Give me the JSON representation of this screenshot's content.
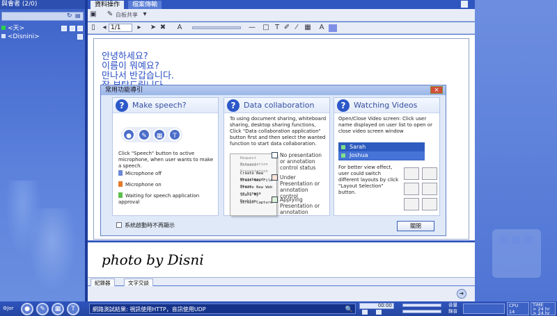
{
  "left_panel": {
    "header": "與會者 (2/0)",
    "users": [
      {
        "name": "<天>",
        "status_color": "#2bd14b"
      },
      {
        "name": "<Disnini>",
        "status_color": "#d9e4fb"
      }
    ]
  },
  "tabs": [
    {
      "label": "資料操作",
      "active": true
    },
    {
      "label": "檔案傳輸",
      "active": false
    }
  ],
  "toolbar1": {
    "whiteboard_share": "白板共享"
  },
  "toolbar2": {
    "page_value": "1/1"
  },
  "whiteboard": {
    "korean_lines": [
      "안녕하세요?",
      "이름이 뭐예요?",
      "만나서 반갑습니다.",
      "잘 부탁드립니다."
    ]
  },
  "dialog": {
    "title": "常用功能導引",
    "close_label": "×",
    "panels": {
      "speech": {
        "title": "Make speech?",
        "description": "Click \"Speech\" button to active microphone, when user wants to make a speech.",
        "legend": [
          {
            "label": "Microphone off",
            "color": "#6a88d6"
          },
          {
            "label": "Microphone on",
            "color": "#e47b2d"
          },
          {
            "label": "Waiting for speech application approval",
            "color": "#5cbf4e"
          }
        ]
      },
      "collab": {
        "title": "Data collaboration",
        "description": "To using document sharing, whiteboard sharing, desktop sharing functions, Click \"Data collaboration application\" button first and then select the wanted function to start data collaboration.",
        "menu_items": [
          "Request Presentation",
          "Release Presentation",
          "Create New Whiteboard",
          "Creat New File Share",
          "Create New Web co-browse",
          "Share My Desktop",
          "Screen Capture"
        ],
        "features": [
          "No presentation or annotation control status",
          "Under Presentation or annotation control",
          "Applying Presentation or annotation"
        ]
      },
      "video": {
        "title": "Watching Videos",
        "description": "Open/Close Video screen: Click user name displayed on user list to open or close video screen window",
        "users": [
          "Sarah",
          "Joshua"
        ],
        "layout_text": "For better view effect, user could switch different layouts by click \"Layout Selection\" button."
      }
    },
    "checkbox_label": "系統啟動時不再顯示",
    "ok_label": "關閉"
  },
  "chat": {
    "watermark": "photo by Disni",
    "tabs": [
      "紀錄器",
      "文字交談"
    ]
  },
  "statusbar": {
    "message": "網路測試結果: 視訊使用HTTP，音訊使用UDP",
    "time": "00:00",
    "cpu_label": "CPU",
    "cpu_value": "14",
    "time_label": "TIME",
    "rx": "> 24 hr",
    "tx": "> 24 hr",
    "audio_label": "音量",
    "playback_label": "播放",
    "rec_label": "錄音"
  }
}
